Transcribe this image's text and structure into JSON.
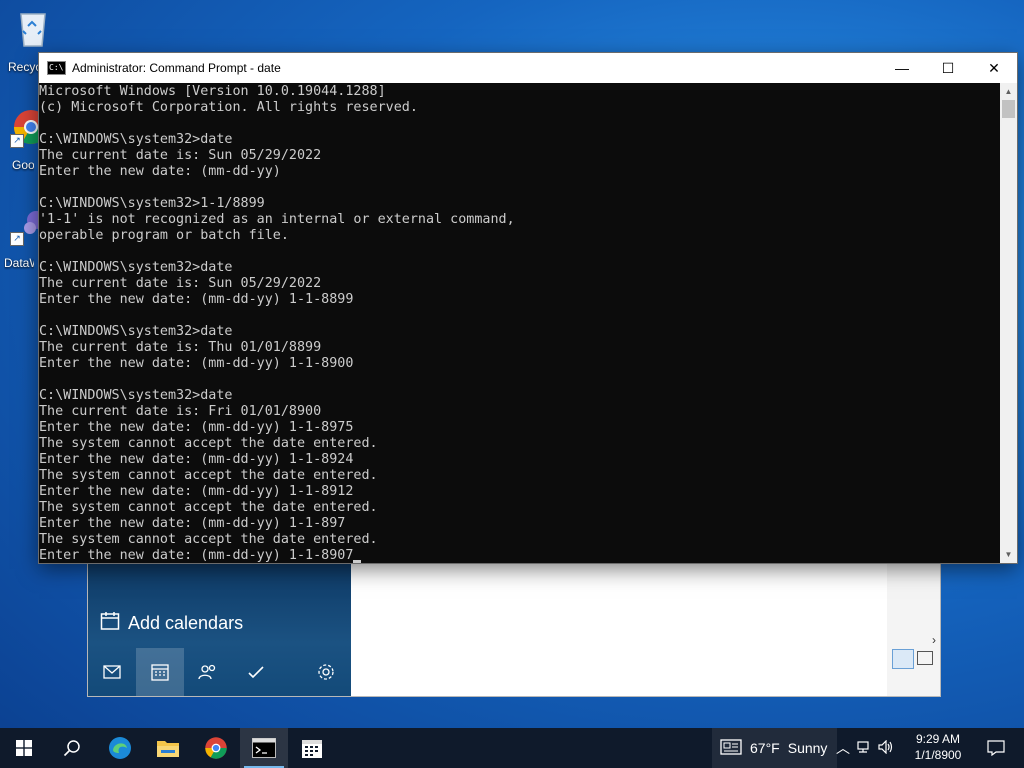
{
  "desktop": {
    "icons": [
      {
        "label": "Recycle Bin",
        "icon": "recycle-bin-icon"
      },
      {
        "label": "Google Chrome",
        "icon": "chrome-icon"
      },
      {
        "label": "DataWrangler",
        "icon": "app-icon"
      }
    ]
  },
  "cmd": {
    "title": "Administrator: Command Prompt - date",
    "buttons": {
      "minimize": "—",
      "maximize": "☐",
      "close": "✕"
    },
    "lines": [
      "Microsoft Windows [Version 10.0.19044.1288]",
      "(c) Microsoft Corporation. All rights reserved.",
      "",
      "C:\\WINDOWS\\system32>date",
      "The current date is: Sun 05/29/2022",
      "Enter the new date: (mm-dd-yy)",
      "",
      "C:\\WINDOWS\\system32>1-1/8899",
      "'1-1' is not recognized as an internal or external command,",
      "operable program or batch file.",
      "",
      "C:\\WINDOWS\\system32>date",
      "The current date is: Sun 05/29/2022",
      "Enter the new date: (mm-dd-yy) 1-1-8899",
      "",
      "C:\\WINDOWS\\system32>date",
      "The current date is: Thu 01/01/8899",
      "Enter the new date: (mm-dd-yy) 1-1-8900",
      "",
      "C:\\WINDOWS\\system32>date",
      "The current date is: Fri 01/01/8900",
      "Enter the new date: (mm-dd-yy) 1-1-8975",
      "The system cannot accept the date entered.",
      "Enter the new date: (mm-dd-yy) 1-1-8924",
      "The system cannot accept the date entered.",
      "Enter the new date: (mm-dd-yy) 1-1-8912",
      "The system cannot accept the date entered.",
      "Enter the new date: (mm-dd-yy) 1-1-897",
      "The system cannot accept the date entered.",
      "Enter the new date: (mm-dd-yy) 1-1-8907"
    ]
  },
  "calendar": {
    "add_calendars": "Add calendars",
    "nav_icons": [
      "mail-icon",
      "calendar-icon",
      "people-icon",
      "todo-icon",
      "settings-icon"
    ]
  },
  "taskbar": {
    "icons": [
      "start-icon",
      "search-icon",
      "edge-icon",
      "file-explorer-icon",
      "chrome-icon",
      "command-prompt-icon",
      "calendar-icon"
    ],
    "weather": {
      "temp": "67°F",
      "condition": "Sunny"
    },
    "clock": {
      "time": "9:29 AM",
      "date": "1/1/8900"
    }
  }
}
